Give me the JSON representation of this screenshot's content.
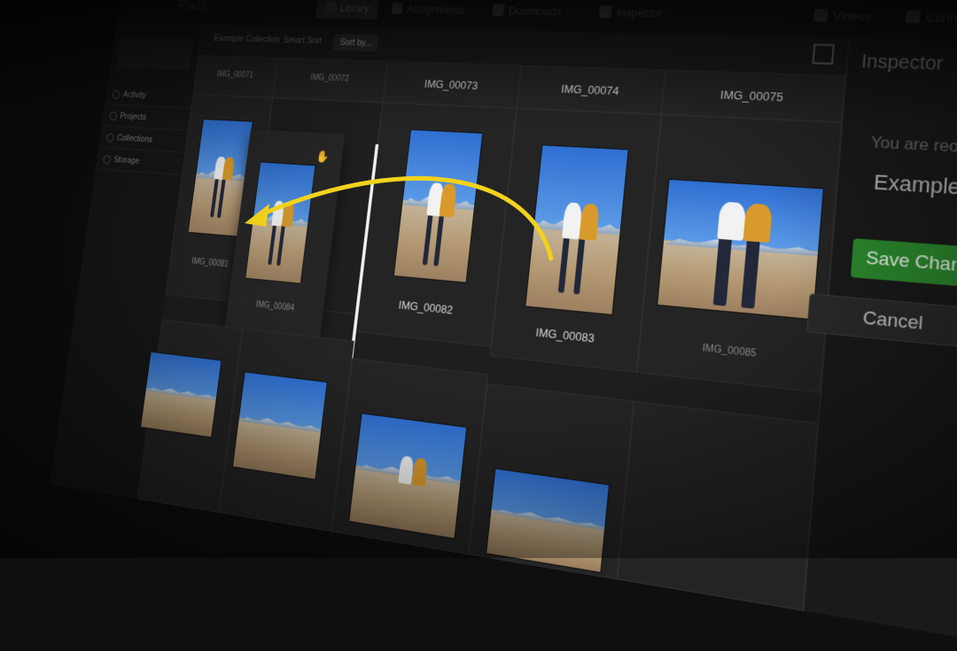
{
  "app": {
    "title": "Pixfs"
  },
  "tabs": [
    {
      "label": "Library"
    },
    {
      "label": "Assignments"
    },
    {
      "label": "Downloads"
    },
    {
      "label": "Inspector"
    },
    {
      "label": "Videos"
    },
    {
      "label": "Connect"
    }
  ],
  "sidebar": {
    "items": [
      {
        "label": "Activity"
      },
      {
        "label": "Projects"
      },
      {
        "label": "Collections"
      },
      {
        "label": "Storage"
      }
    ]
  },
  "toolbar": {
    "crumb": "Example Collection",
    "filter": "Smart Sort",
    "sort_label": "Sort by..."
  },
  "grid": {
    "headers": [
      "IMG_00071",
      "IMG_00072",
      "IMG_00073",
      "IMG_00074",
      "IMG_00075"
    ],
    "photos": [
      {
        "label": "IMG_00081"
      },
      {
        "label": "IMG_00084"
      },
      {
        "label": "IMG_00082"
      },
      {
        "label": "IMG_00083"
      },
      {
        "label": "IMG_00085"
      }
    ]
  },
  "inspector": {
    "title": "Inspector",
    "message": "You are reordering",
    "collection": "Example Collection",
    "save_label": "Save Changes",
    "cancel_label": "Cancel"
  },
  "colors": {
    "accent_arrow": "#f2d21b",
    "save_green": "#2c8a2e",
    "background": "#1b1b1c"
  },
  "icons": [
    "hand-cursor-icon",
    "expand-icon",
    "chevron-down-icon"
  ]
}
